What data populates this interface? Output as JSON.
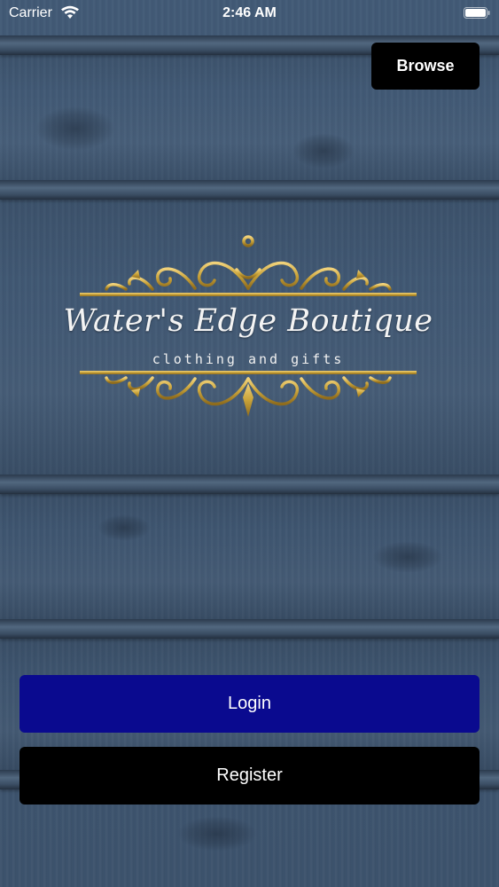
{
  "status_bar": {
    "carrier": "Carrier",
    "time": "2:46 AM",
    "icons": [
      "wifi-icon",
      "battery-icon"
    ]
  },
  "header": {
    "browse_label": "Browse"
  },
  "logo": {
    "title": "Water's Edge Boutique",
    "subtitle": "clothing and gifts",
    "ornament_icon": "anchor-icon"
  },
  "actions": {
    "login_label": "Login",
    "register_label": "Register"
  },
  "colors": {
    "background": "#3f5570",
    "gold": "#c9a33a",
    "login_button": "#0a0a8f",
    "register_button": "#000000",
    "browse_button": "#000000"
  }
}
